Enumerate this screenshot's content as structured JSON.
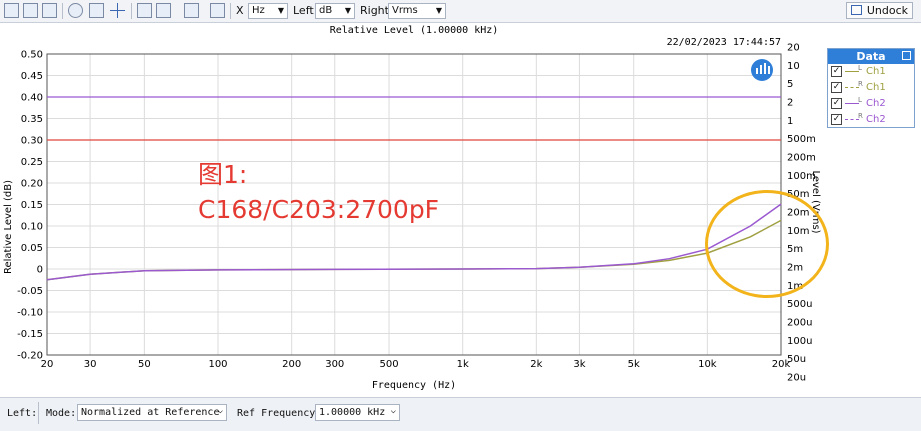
{
  "toolbar": {
    "x_label": "X",
    "x_unit": "Hz",
    "left_label": "Left",
    "left_unit": "dB",
    "right_label": "Right",
    "right_unit": "Vrms",
    "undock_label": "Undock",
    "icons": [
      "save-icon",
      "copy-icon",
      "print-icon",
      "zoom-icon",
      "fit-icon",
      "cursor-icon",
      "panel-icon",
      "graph-options-icon",
      "scale-icon",
      "export-icon"
    ]
  },
  "chart": {
    "title": "Relative Level (1.00000 kHz)",
    "timestamp": "22/02/2023  17:44:57",
    "xlabel": "Frequency (Hz)",
    "ylabel_left": "Relative Level (dB)",
    "ylabel_right": "Level (Vrms)"
  },
  "data_panel": {
    "title": "Data",
    "items": [
      {
        "label": "Ch1",
        "sup": "L",
        "color": "#a0a042",
        "dash": "solid",
        "checked": "✓"
      },
      {
        "label": "Ch1",
        "sup": "R",
        "color": "#a0a042",
        "dash": "dashed",
        "checked": "✓"
      },
      {
        "label": "Ch2",
        "sup": "L",
        "color": "#9b59d0",
        "dash": "solid",
        "checked": "✓"
      },
      {
        "label": "Ch2",
        "sup": "R",
        "color": "#9b59d0",
        "dash": "dashed",
        "checked": "✓"
      }
    ]
  },
  "annotation": {
    "line1": "图1:",
    "line2": "C168/C203:2700pF",
    "color": "#e43a32",
    "circle_color": "#f2b41a"
  },
  "status": {
    "left_label": "Left:",
    "mode_label": "Mode:",
    "mode_value": "Normalized at Reference",
    "ref_label": "Ref Frequency:",
    "ref_value": "1.00000 kHz"
  },
  "chart_data": {
    "type": "line",
    "title": "Relative Level (1.00000 kHz)",
    "xlabel": "Frequency (Hz)",
    "ylabel": "Relative Level (dB)",
    "y2label": "Level (Vrms)",
    "x_scale": "log",
    "xlim": [
      20,
      20000
    ],
    "ylim": [
      -0.2,
      0.5
    ],
    "x_ticks": [
      20,
      30,
      50,
      100,
      200,
      300,
      500,
      1000,
      2000,
      3000,
      5000,
      10000,
      20000
    ],
    "x_tick_labels": [
      "20",
      "30",
      "50",
      "100",
      "200",
      "300",
      "500",
      "1k",
      "2k",
      "3k",
      "5k",
      "10k",
      "20k"
    ],
    "y_ticks": [
      0.5,
      0.45,
      0.4,
      0.35,
      0.3,
      0.25,
      0.2,
      0.15,
      0.1,
      0.05,
      0,
      -0.05,
      -0.1,
      -0.15,
      -0.2
    ],
    "y_tick_labels": [
      "0.50",
      "0.45",
      "0.40",
      "0.35",
      "0.30",
      "0.25",
      "0.20",
      "0.15",
      "0.10",
      "0.05",
      "0",
      "-0.05",
      "-0.10",
      "-0.15",
      "-0.20"
    ],
    "y2_tick_labels": [
      "20",
      "10",
      "5",
      "2",
      "1",
      "500m",
      "200m",
      "100m",
      "50m",
      "20m",
      "10m",
      "5m",
      "2m",
      "1m",
      "500u",
      "200u",
      "100u",
      "50u",
      "20u"
    ],
    "grid": true,
    "series": [
      {
        "name": "Ch1",
        "color": "#a0a042",
        "points": [
          [
            20,
            -0.025
          ],
          [
            30,
            -0.012
          ],
          [
            50,
            -0.004
          ],
          [
            100,
            -0.002
          ],
          [
            300,
            -0.001
          ],
          [
            1000,
            0
          ],
          [
            2000,
            0.001
          ],
          [
            3000,
            0.004
          ],
          [
            5000,
            0.011
          ],
          [
            7000,
            0.02
          ],
          [
            10000,
            0.037
          ],
          [
            15000,
            0.075
          ],
          [
            20000,
            0.113
          ]
        ]
      },
      {
        "name": "Ch2",
        "color": "#9b59d0",
        "points": [
          [
            20,
            -0.025
          ],
          [
            30,
            -0.012
          ],
          [
            50,
            -0.004
          ],
          [
            100,
            -0.002
          ],
          [
            300,
            -0.001
          ],
          [
            1000,
            0
          ],
          [
            2000,
            0.001
          ],
          [
            3000,
            0.004
          ],
          [
            5000,
            0.012
          ],
          [
            7000,
            0.024
          ],
          [
            10000,
            0.046
          ],
          [
            15000,
            0.1
          ],
          [
            20000,
            0.151
          ]
        ]
      }
    ],
    "reference_lines": [
      {
        "y": 0.4,
        "color": "#9b59d0"
      },
      {
        "y": 0.3,
        "color": "#e0443c"
      }
    ]
  }
}
